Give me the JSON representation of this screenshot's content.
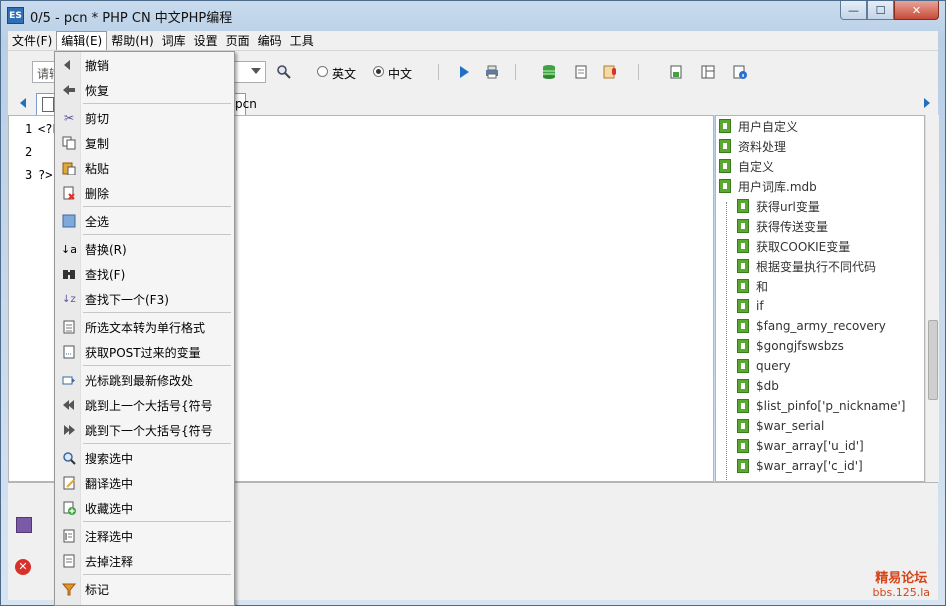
{
  "window": {
    "title": "0/5 - pcn * PHP CN 中文PHP编程",
    "app_icon_text": "ES",
    "minimize": "—",
    "maximize": "☐",
    "close": "✕"
  },
  "menubar": {
    "items": [
      "文件(F)",
      "编辑(E)",
      "帮助(H)",
      "词库",
      "设置",
      "页面",
      "编码",
      "工具"
    ]
  },
  "toolbar": {
    "combo_placeholder": "请输",
    "radio_english": "英文",
    "radio_chinese": "中文",
    "selected_radio": "中文"
  },
  "tabs": {
    "active_label": "pcn"
  },
  "editor": {
    "lines": [
      {
        "num": "1",
        "code": "<?P"
      },
      {
        "num": "2",
        "code": ""
      },
      {
        "num": "3",
        "code": "?>"
      }
    ]
  },
  "tree": {
    "roots": [
      "用户自定义",
      "资料处理",
      "自定义",
      "用户词库.mdb"
    ],
    "children": [
      "获得url变量",
      "获得传送变量",
      "获取COOKIE变量",
      "根据变量执行不同代码",
      "和",
      "if",
      "$fang_army_recovery",
      "$gongjfswsbzs",
      "query",
      "$db",
      "$list_pinfo['p_nickname']",
      "$war_serial",
      "$war_array['u_id']",
      "$war_array['c_id']"
    ]
  },
  "context_menu": {
    "groups": [
      [
        {
          "label": "撤销",
          "icon": "undo-icon"
        },
        {
          "label": "恢复",
          "icon": "redo-icon"
        }
      ],
      [
        {
          "label": "剪切",
          "icon": "scissors-icon"
        },
        {
          "label": "复制",
          "icon": "copy-icon"
        },
        {
          "label": "粘贴",
          "icon": "paste-icon"
        },
        {
          "label": "删除",
          "icon": "delete-icon"
        }
      ],
      [
        {
          "label": "全选",
          "icon": "select-all-icon"
        }
      ],
      [
        {
          "label": "替换(R)",
          "icon": "replace-icon"
        },
        {
          "label": "查找(F)",
          "icon": "binoculars-icon"
        },
        {
          "label": "查找下一个(F3)",
          "icon": "find-next-icon"
        }
      ],
      [
        {
          "label": "所选文本转为单行格式",
          "icon": "single-line-icon"
        },
        {
          "label": "获取POST过来的变量",
          "icon": "post-vars-icon"
        }
      ],
      [
        {
          "label": "光标跳到最新修改处",
          "icon": "jump-cursor-icon"
        },
        {
          "label": "跳到上一个大括号{符号",
          "icon": "double-left-arrow-icon"
        },
        {
          "label": "跳到下一个大括号{符号",
          "icon": "double-right-arrow-icon"
        }
      ],
      [
        {
          "label": "搜索选中",
          "icon": "search-icon"
        },
        {
          "label": "翻译选中",
          "icon": "translate-icon"
        },
        {
          "label": "收藏选中",
          "icon": "favorite-icon"
        }
      ],
      [
        {
          "label": "注释选中",
          "icon": "comment-icon"
        },
        {
          "label": "去掉注释",
          "icon": "uncomment-icon"
        }
      ],
      [
        {
          "label": "标记",
          "icon": "funnel-icon"
        }
      ]
    ]
  },
  "watermark": {
    "title": "精易论坛",
    "url": "bbs.125.la"
  },
  "colors": {
    "tree_leaf_green": "#5aa832",
    "accent_blue": "#1f6fc2",
    "watermark_orange": "#d64418"
  }
}
